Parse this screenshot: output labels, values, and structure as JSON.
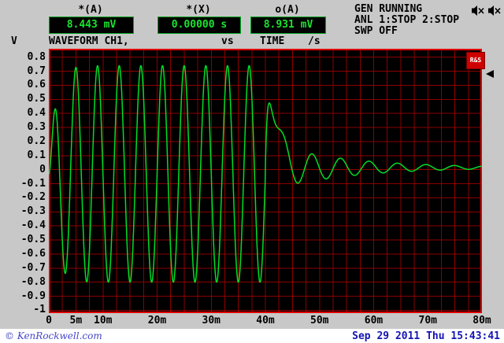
{
  "header": {
    "readouts": [
      {
        "label": "*(A)",
        "value": "8.443 mV"
      },
      {
        "label": "*(X)",
        "value": "0.00000 s"
      },
      {
        "label": "o(A)",
        "value": "8.931 mV"
      }
    ],
    "status_lines": [
      "GEN RUNNING",
      "ANL 1:STOP 2:STOP",
      "SWP OFF"
    ],
    "icons": [
      "speaker-muted-icon",
      "speaker-muted-icon"
    ]
  },
  "plot_header": {
    "y_unit": "V",
    "trace_label": "WAVEFORM CH1,",
    "vs_label": "vs",
    "x_label": "TIME",
    "x_unit": "/s"
  },
  "logo": {
    "label": "R&S"
  },
  "footer": {
    "watermark": "© KenRockwell.com",
    "datetime": "Sep 29 2011 Thu 15:43:41"
  },
  "chart_data": {
    "type": "line",
    "title": "WAVEFORM CH1 vs TIME /s",
    "xlabel": "TIME /s",
    "ylabel": "V",
    "xlim": [
      0,
      0.08
    ],
    "ylim": [
      -1.02,
      0.86
    ],
    "grid": {
      "x_step": 0.0025,
      "y_step": 0.1,
      "on": true
    },
    "x_ticks": [
      {
        "value": 0.0,
        "label": "0"
      },
      {
        "value": 0.005,
        "label": "5m"
      },
      {
        "value": 0.01,
        "label": "10m"
      },
      {
        "value": 0.02,
        "label": "20m"
      },
      {
        "value": 0.03,
        "label": "30m"
      },
      {
        "value": 0.04,
        "label": "40m"
      },
      {
        "value": 0.05,
        "label": "50m"
      },
      {
        "value": 0.06,
        "label": "60m"
      },
      {
        "value": 0.07,
        "label": "70m"
      },
      {
        "value": 0.08,
        "label": "80m"
      }
    ],
    "y_ticks": [
      {
        "value": 0.8,
        "label": "0.8"
      },
      {
        "value": 0.7,
        "label": "0.7"
      },
      {
        "value": 0.6,
        "label": "0.6"
      },
      {
        "value": 0.5,
        "label": "0.5"
      },
      {
        "value": 0.4,
        "label": "0.4"
      },
      {
        "value": 0.3,
        "label": "0.3"
      },
      {
        "value": 0.2,
        "label": "0.2"
      },
      {
        "value": 0.1,
        "label": "0.1"
      },
      {
        "value": 0.0,
        "label": "0"
      },
      {
        "value": -0.1,
        "label": "-0.1"
      },
      {
        "value": -0.2,
        "label": "-0.2"
      },
      {
        "value": -0.3,
        "label": "-0.3"
      },
      {
        "value": -0.4,
        "label": "-0.4"
      },
      {
        "value": -0.5,
        "label": "-0.5"
      },
      {
        "value": -0.6,
        "label": "-0.6"
      },
      {
        "value": -0.7,
        "label": "-0.7"
      },
      {
        "value": -0.8,
        "label": "-0.8"
      },
      {
        "value": -0.9,
        "label": "-0.9"
      },
      {
        "value": -1.0,
        "label": "-1"
      }
    ],
    "colors": {
      "trace": "#00dc28",
      "grid": "#8c0000",
      "frame": "#e00000",
      "bg": "#000000",
      "panel": "#c8c8c8",
      "readout_green": "#1ae42e",
      "footer_blue": "#1414b4"
    },
    "signal": {
      "description": "≈250 Hz tone burst from 0 to 40 ms, peak ≈ +0.74 V / -0.80 V, followed at 40 ms by a transient spike to ≈ +0.4 V and a decaying ≈190 Hz ripple settling toward ≈ +0.02 V at 80 ms",
      "burst": {
        "t_start": 0,
        "t_end": 0.04,
        "freq": 250,
        "amplitude": 0.77,
        "attack_tau": 0.0012,
        "offset": -0.03
      },
      "ring": {
        "t_start": 0.04,
        "offset": 0.015,
        "spike_amp": 0.55,
        "spike_rise": 0.0008,
        "osc_amp": 0.18,
        "osc_freq": 190,
        "osc_phase": 3.83,
        "osc_tau": 0.014,
        "osc_delay_tau": 0.001
      }
    }
  }
}
